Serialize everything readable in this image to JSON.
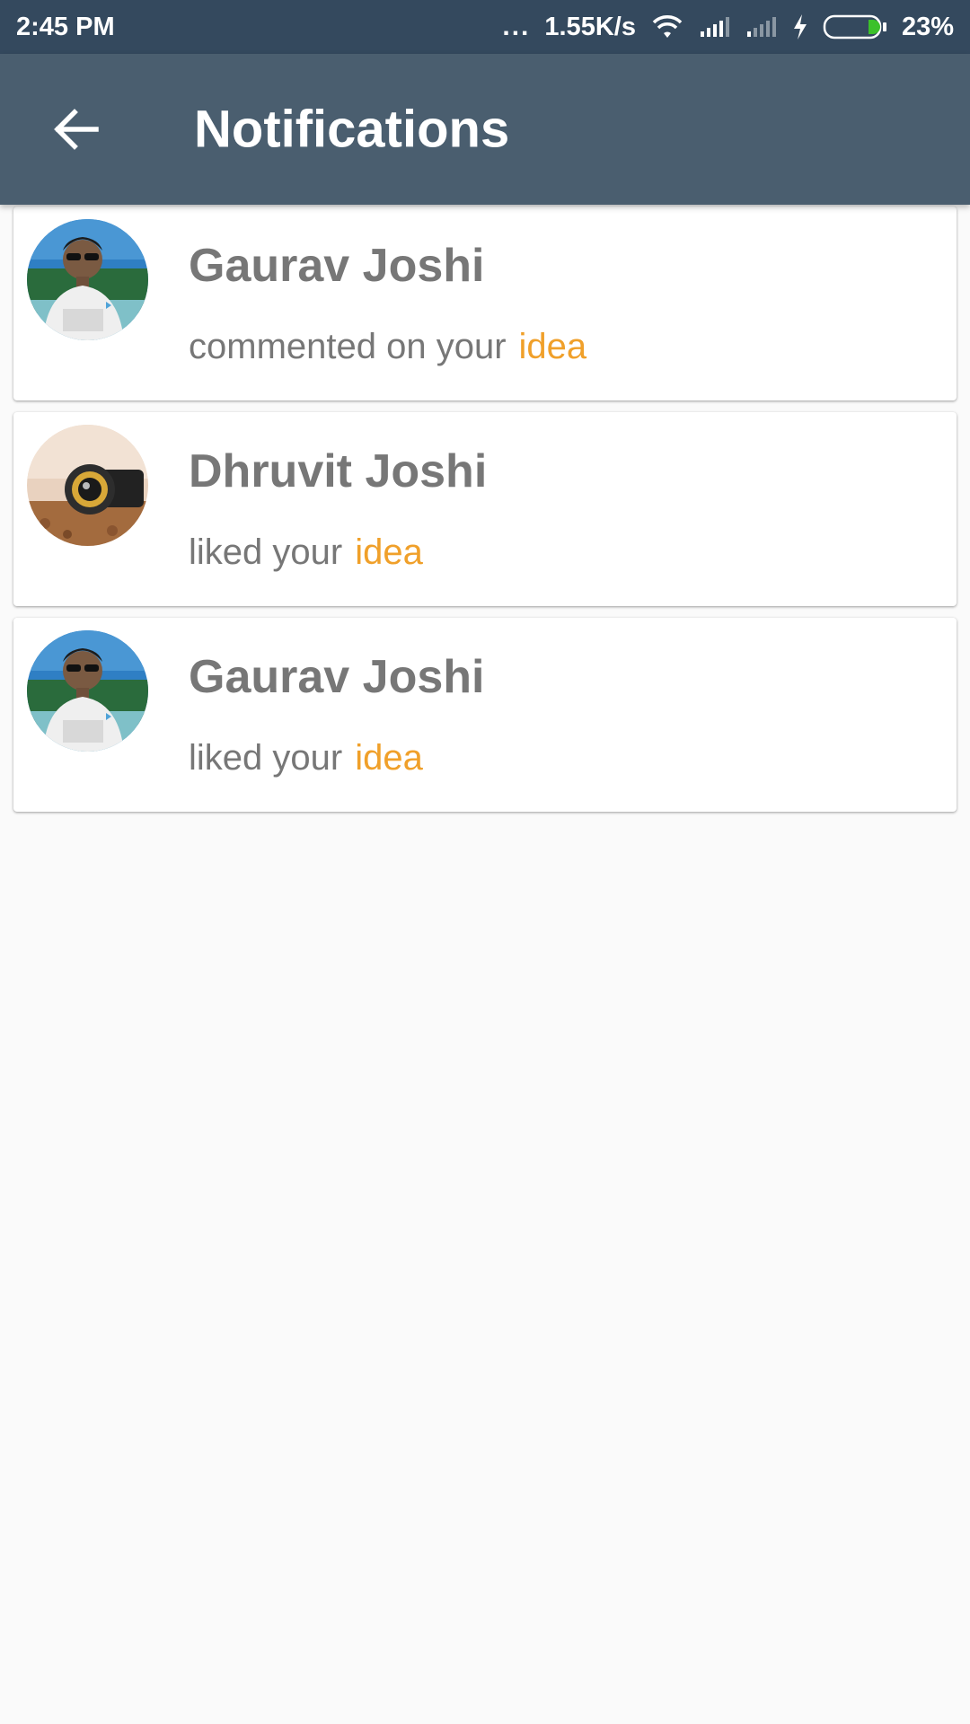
{
  "status_bar": {
    "time": "2:45 PM",
    "dots": "...",
    "network_speed": "1.55K/s",
    "battery_percent": "23%",
    "battery_level": 0.23,
    "battery_color": "#3cc12a"
  },
  "app_bar": {
    "title": "Notifications",
    "back_icon": "arrow-left-icon"
  },
  "colors": {
    "status_bar_bg": "#34495e",
    "app_bar_bg": "#4a5e6f",
    "link": "#f0a02a",
    "text": "#777777"
  },
  "notifications": [
    {
      "name": "Gaurav Joshi",
      "action": "commented on your",
      "link": "idea",
      "avatar": "person-photo"
    },
    {
      "name": "Dhruvit Joshi",
      "action": "liked your",
      "link": "idea",
      "avatar": "camera-lens-photo"
    },
    {
      "name": "Gaurav Joshi",
      "action": "liked your",
      "link": "idea",
      "avatar": "person-photo"
    }
  ]
}
